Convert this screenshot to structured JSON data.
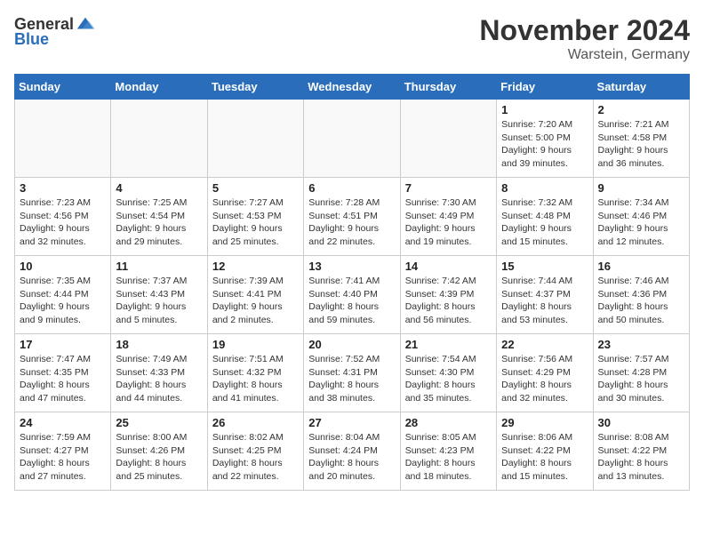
{
  "header": {
    "logo_general": "General",
    "logo_blue": "Blue",
    "month_title": "November 2024",
    "location": "Warstein, Germany"
  },
  "weekdays": [
    "Sunday",
    "Monday",
    "Tuesday",
    "Wednesday",
    "Thursday",
    "Friday",
    "Saturday"
  ],
  "weeks": [
    [
      {
        "day": "",
        "info": ""
      },
      {
        "day": "",
        "info": ""
      },
      {
        "day": "",
        "info": ""
      },
      {
        "day": "",
        "info": ""
      },
      {
        "day": "",
        "info": ""
      },
      {
        "day": "1",
        "info": "Sunrise: 7:20 AM\nSunset: 5:00 PM\nDaylight: 9 hours and 39 minutes."
      },
      {
        "day": "2",
        "info": "Sunrise: 7:21 AM\nSunset: 4:58 PM\nDaylight: 9 hours and 36 minutes."
      }
    ],
    [
      {
        "day": "3",
        "info": "Sunrise: 7:23 AM\nSunset: 4:56 PM\nDaylight: 9 hours and 32 minutes."
      },
      {
        "day": "4",
        "info": "Sunrise: 7:25 AM\nSunset: 4:54 PM\nDaylight: 9 hours and 29 minutes."
      },
      {
        "day": "5",
        "info": "Sunrise: 7:27 AM\nSunset: 4:53 PM\nDaylight: 9 hours and 25 minutes."
      },
      {
        "day": "6",
        "info": "Sunrise: 7:28 AM\nSunset: 4:51 PM\nDaylight: 9 hours and 22 minutes."
      },
      {
        "day": "7",
        "info": "Sunrise: 7:30 AM\nSunset: 4:49 PM\nDaylight: 9 hours and 19 minutes."
      },
      {
        "day": "8",
        "info": "Sunrise: 7:32 AM\nSunset: 4:48 PM\nDaylight: 9 hours and 15 minutes."
      },
      {
        "day": "9",
        "info": "Sunrise: 7:34 AM\nSunset: 4:46 PM\nDaylight: 9 hours and 12 minutes."
      }
    ],
    [
      {
        "day": "10",
        "info": "Sunrise: 7:35 AM\nSunset: 4:44 PM\nDaylight: 9 hours and 9 minutes."
      },
      {
        "day": "11",
        "info": "Sunrise: 7:37 AM\nSunset: 4:43 PM\nDaylight: 9 hours and 5 minutes."
      },
      {
        "day": "12",
        "info": "Sunrise: 7:39 AM\nSunset: 4:41 PM\nDaylight: 9 hours and 2 minutes."
      },
      {
        "day": "13",
        "info": "Sunrise: 7:41 AM\nSunset: 4:40 PM\nDaylight: 8 hours and 59 minutes."
      },
      {
        "day": "14",
        "info": "Sunrise: 7:42 AM\nSunset: 4:39 PM\nDaylight: 8 hours and 56 minutes."
      },
      {
        "day": "15",
        "info": "Sunrise: 7:44 AM\nSunset: 4:37 PM\nDaylight: 8 hours and 53 minutes."
      },
      {
        "day": "16",
        "info": "Sunrise: 7:46 AM\nSunset: 4:36 PM\nDaylight: 8 hours and 50 minutes."
      }
    ],
    [
      {
        "day": "17",
        "info": "Sunrise: 7:47 AM\nSunset: 4:35 PM\nDaylight: 8 hours and 47 minutes."
      },
      {
        "day": "18",
        "info": "Sunrise: 7:49 AM\nSunset: 4:33 PM\nDaylight: 8 hours and 44 minutes."
      },
      {
        "day": "19",
        "info": "Sunrise: 7:51 AM\nSunset: 4:32 PM\nDaylight: 8 hours and 41 minutes."
      },
      {
        "day": "20",
        "info": "Sunrise: 7:52 AM\nSunset: 4:31 PM\nDaylight: 8 hours and 38 minutes."
      },
      {
        "day": "21",
        "info": "Sunrise: 7:54 AM\nSunset: 4:30 PM\nDaylight: 8 hours and 35 minutes."
      },
      {
        "day": "22",
        "info": "Sunrise: 7:56 AM\nSunset: 4:29 PM\nDaylight: 8 hours and 32 minutes."
      },
      {
        "day": "23",
        "info": "Sunrise: 7:57 AM\nSunset: 4:28 PM\nDaylight: 8 hours and 30 minutes."
      }
    ],
    [
      {
        "day": "24",
        "info": "Sunrise: 7:59 AM\nSunset: 4:27 PM\nDaylight: 8 hours and 27 minutes."
      },
      {
        "day": "25",
        "info": "Sunrise: 8:00 AM\nSunset: 4:26 PM\nDaylight: 8 hours and 25 minutes."
      },
      {
        "day": "26",
        "info": "Sunrise: 8:02 AM\nSunset: 4:25 PM\nDaylight: 8 hours and 22 minutes."
      },
      {
        "day": "27",
        "info": "Sunrise: 8:04 AM\nSunset: 4:24 PM\nDaylight: 8 hours and 20 minutes."
      },
      {
        "day": "28",
        "info": "Sunrise: 8:05 AM\nSunset: 4:23 PM\nDaylight: 8 hours and 18 minutes."
      },
      {
        "day": "29",
        "info": "Sunrise: 8:06 AM\nSunset: 4:22 PM\nDaylight: 8 hours and 15 minutes."
      },
      {
        "day": "30",
        "info": "Sunrise: 8:08 AM\nSunset: 4:22 PM\nDaylight: 8 hours and 13 minutes."
      }
    ]
  ]
}
